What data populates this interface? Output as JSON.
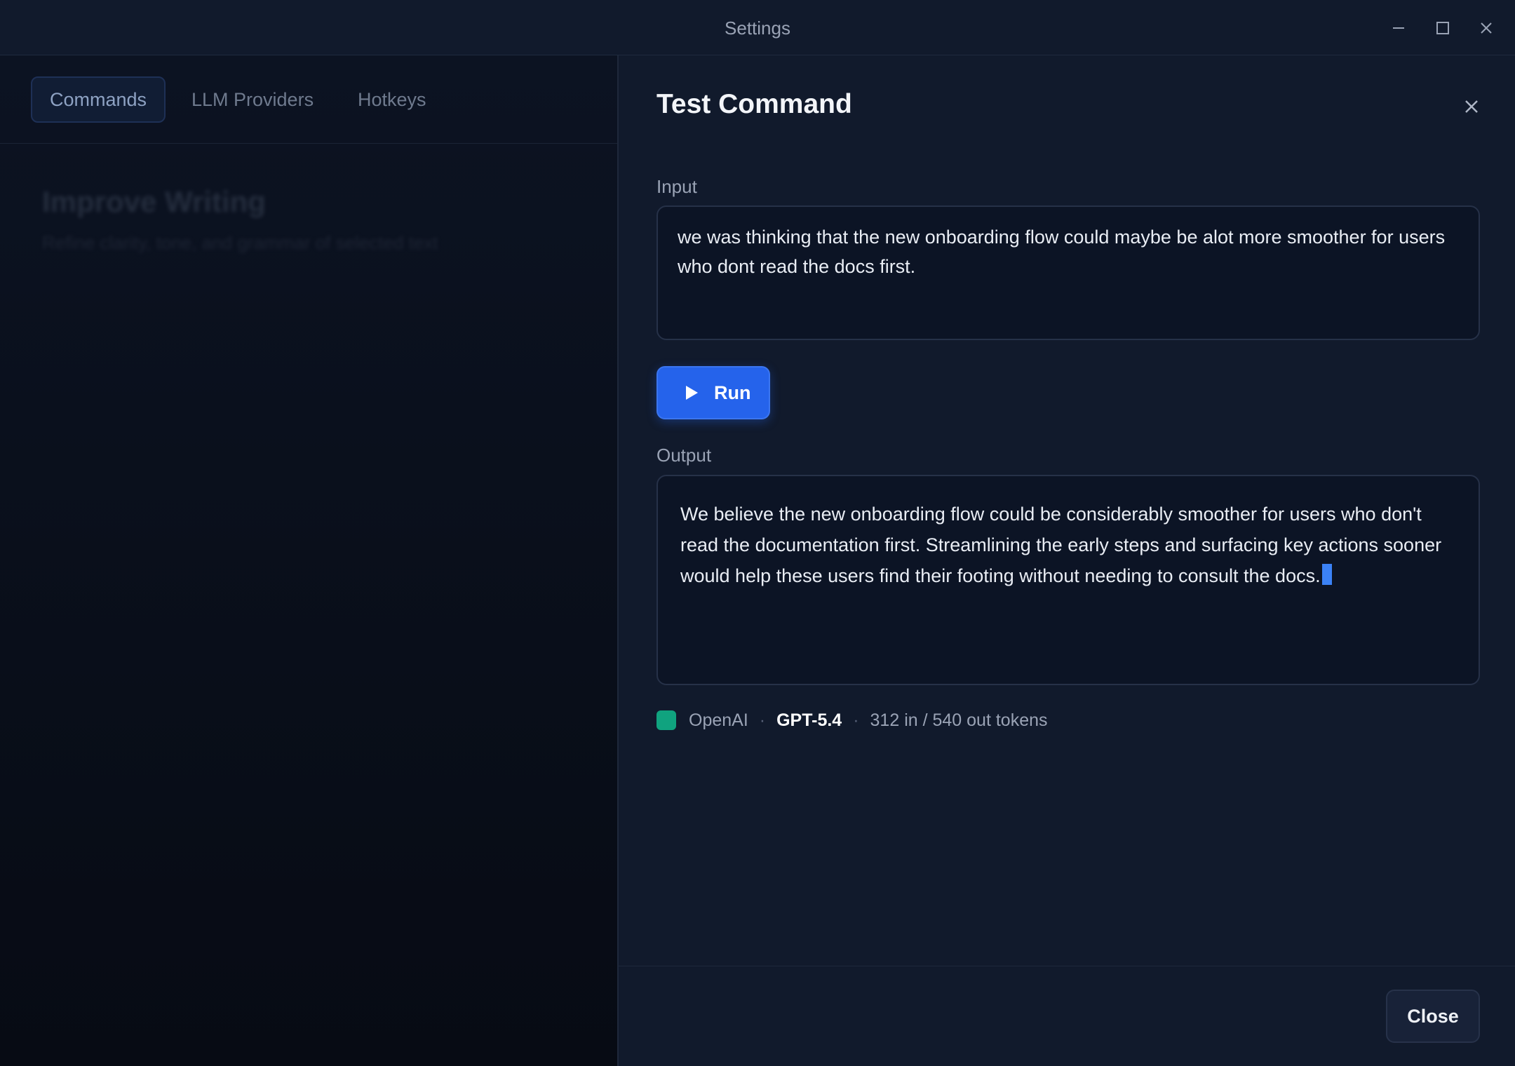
{
  "window": {
    "title": "Settings",
    "controls": [
      "minimize-icon",
      "maximize-icon",
      "close-icon"
    ]
  },
  "settings": {
    "tabs": [
      {
        "label": "Commands",
        "active": true
      },
      {
        "label": "LLM Providers",
        "active": false
      },
      {
        "label": "Hotkeys",
        "active": false
      }
    ],
    "command": {
      "title": "Improve Writing",
      "description": "Refine clarity, tone, and grammar of selected text"
    }
  },
  "test_panel": {
    "title": "Test Command",
    "input_label": "Input",
    "input_value": "we was thinking that the new onboarding flow could maybe be alot more smoother for users who dont read the docs first.",
    "run_label": "Run",
    "output_label": "Output",
    "output_value": "We believe the new onboarding flow could be considerably smoother for users who don't read the documentation first. Streamlining the early steps and surfacing key actions sooner would help these users find their footing without needing to consult the docs.",
    "provider": "OpenAI",
    "provider_color": "#10a37f",
    "model": "GPT-5.4",
    "tokens": "312 in / 540 out tokens",
    "separator": "·",
    "close_label": "Close"
  },
  "colors": {
    "accent": "#2563eb",
    "cursor": "#3b82f6",
    "background": "#111a2c"
  }
}
